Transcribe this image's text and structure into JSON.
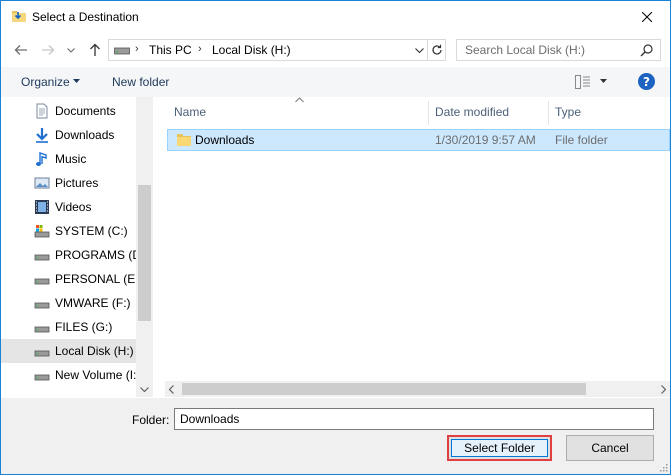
{
  "window": {
    "title": "Select a Destination"
  },
  "address": {
    "crumbs": [
      "This PC",
      "Local Disk (H:)"
    ],
    "separator": "›"
  },
  "search": {
    "placeholder": "Search Local Disk (H:)"
  },
  "commandbar": {
    "organize": "Organize",
    "new_folder": "New folder"
  },
  "nav": {
    "items": [
      {
        "label": "Documents",
        "icon": "documents-icon"
      },
      {
        "label": "Downloads",
        "icon": "downloads-icon"
      },
      {
        "label": "Music",
        "icon": "music-icon"
      },
      {
        "label": "Pictures",
        "icon": "pictures-icon"
      },
      {
        "label": "Videos",
        "icon": "videos-icon"
      },
      {
        "label": "SYSTEM (C:)",
        "icon": "system-drive-icon"
      },
      {
        "label": "PROGRAMS (D:",
        "icon": "drive-icon"
      },
      {
        "label": "PERSONAL (E:)",
        "icon": "drive-icon"
      },
      {
        "label": "VMWARE (F:)",
        "icon": "drive-icon"
      },
      {
        "label": "FILES (G:)",
        "icon": "drive-icon"
      },
      {
        "label": "Local Disk (H:)",
        "icon": "drive-icon",
        "selected": true
      },
      {
        "label": "New Volume (I:",
        "icon": "drive-icon"
      }
    ]
  },
  "columns": {
    "name": "Name",
    "date": "Date modified",
    "type": "Type"
  },
  "rows": [
    {
      "name": "Downloads",
      "date": "1/30/2019 9:57 AM",
      "type": "File folder",
      "selected": true
    }
  ],
  "bottom": {
    "folder_label": "Folder:",
    "folder_value": "Downloads",
    "select_button": "Select Folder",
    "cancel_button": "Cancel"
  },
  "colors": {
    "accent": "#0078d7",
    "highlight": "#cce8ff",
    "select_outline": "#e04040"
  }
}
